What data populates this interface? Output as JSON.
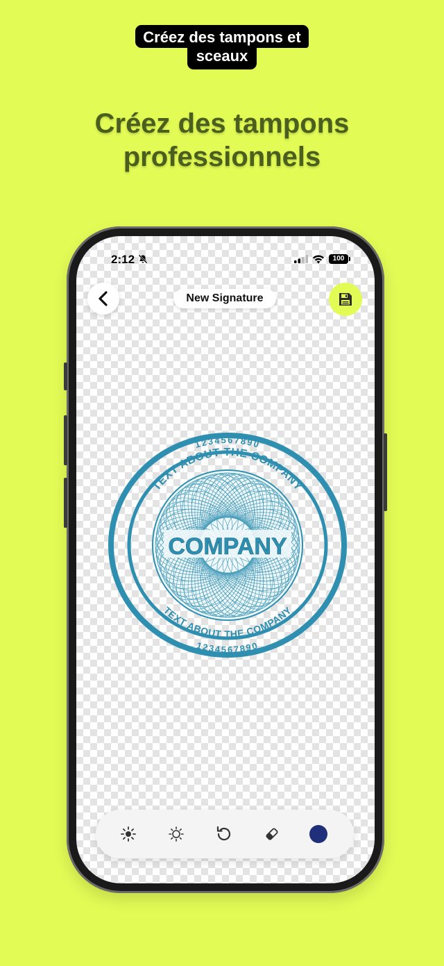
{
  "badge": {
    "line1": "Créez des tampons et",
    "line2": "sceaux"
  },
  "headline": {
    "line1": "Créez des tampons",
    "line2": "professionnels"
  },
  "status_bar": {
    "time": "2:12",
    "battery": "100"
  },
  "header": {
    "title": "New Signature",
    "back_icon": "chevron-left-icon",
    "save_icon": "floppy-disk-icon"
  },
  "stamp": {
    "center_text": "COMPANY",
    "ring_text": "TEXT ABOUT THE COMPANY",
    "ring_numbers": "1234567890",
    "color": "#2e8fb0"
  },
  "toolbar": {
    "tools": [
      "brightness-icon",
      "contrast-icon",
      "rotate-icon",
      "eraser-icon",
      "color-picker"
    ],
    "selected_color": "#1f2f7a"
  },
  "colors": {
    "background": "#e2fb55",
    "headline": "#4a5e1e"
  }
}
